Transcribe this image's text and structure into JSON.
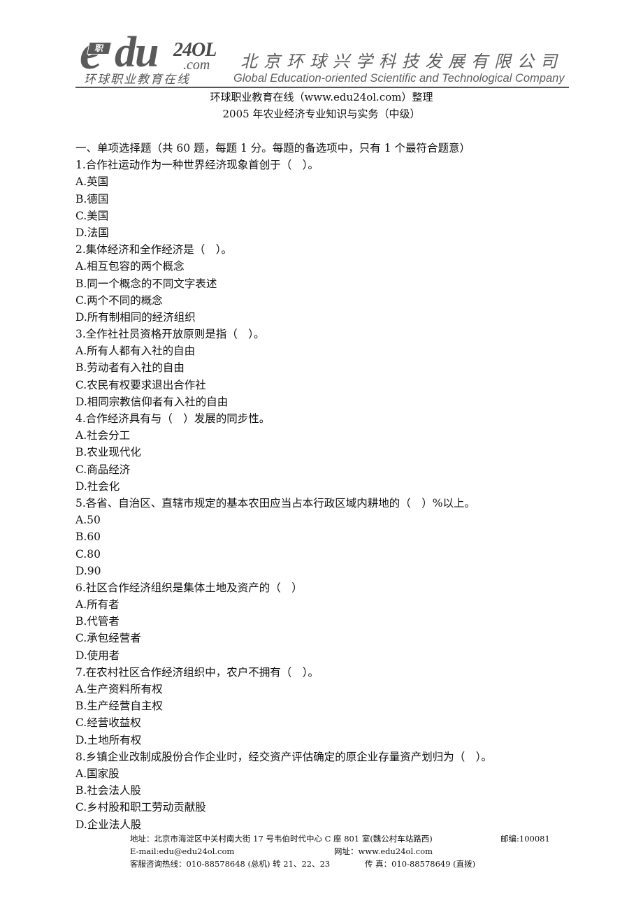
{
  "letterhead": {
    "logo_badge": "职",
    "logo_e": "e",
    "logo_du": "du",
    "logo_24ol": "24OL",
    "logo_com": ".com",
    "logo_cn": "环球职业教育在线",
    "company_cn": "北京环球兴学科技发展有限公司",
    "company_en": "Global Education-oriented Scientific and Technological Company",
    "brand_color": "#5a5a5a"
  },
  "titles": {
    "source": "环球职业教育在线（www.edu24ol.com）整理",
    "exam": "2005 年农业经济专业知识与实务（中级）"
  },
  "section": {
    "heading": "一、单项选择题（共 60 题，每题 1 分。每题的备选项中，只有 1 个最符合题意）"
  },
  "questions": [
    {
      "stem": "1.合作社运动作为一种世界经济现象首创于（　）。",
      "options": [
        "A.英国",
        "B.德国",
        "C.美国",
        "D.法国"
      ]
    },
    {
      "stem": "2.集体经济和全作经济是（　）。",
      "options": [
        "A.相互包容的两个概念",
        "B.同一个概念的不同文字表述",
        "C.两个不同的概念",
        "D.所有制相同的经济组织"
      ]
    },
    {
      "stem": "3.全作社社员资格开放原则是指（　）。",
      "options": [
        "A.所有人都有入社的自由",
        "B.劳动者有入社的自由",
        "C.农民有权要求退出合作社",
        "D.相同宗教信仰者有入社的自由"
      ]
    },
    {
      "stem": "4.合作经济具有与（　）发展的同步性。",
      "options": [
        "A.社会分工",
        "B.农业现代化",
        "C.商品经济",
        "D.社会化"
      ]
    },
    {
      "stem": "5.各省、自治区、直辖市规定的基本农田应当占本行政区域内耕地的（　）%以上。",
      "options": [
        "A.50",
        "B.60",
        "C.80",
        "D.90"
      ]
    },
    {
      "stem": "6.社区合作经济组织是集体土地及资产的（　）",
      "options": [
        "A.所有者",
        "B.代管者",
        "C.承包经营者",
        "D.使用者"
      ]
    },
    {
      "stem": "7.在农村社区合作经济组织中，农户不拥有（　）。",
      "options": [
        "A.生产资料所有权",
        "B.生产经营自主权",
        "C.经营收益权",
        "D.土地所有权"
      ]
    },
    {
      "stem": "8.乡镇企业改制成股份合作企业时，经交资产评估确定的原企业存量资产划归为（　）。",
      "options": [
        "A.国家股",
        "B.社会法人股",
        "C.乡村股和职工劳动贡献股",
        "D.企业法人股"
      ]
    }
  ],
  "footer": {
    "address": "地址：北京市海淀区中关村南大街 17 号韦伯时代中心 C 座 801 室(魏公村车站路西)",
    "postcode": "邮编:100081",
    "email": "E-mail:edu@edu24ol.com",
    "website": "网址：www.edu24ol.com",
    "hotline": "客服咨询热线：010-88578648 (总机) 转 21、22、23",
    "fax": "传 真：010-88578649 (直拨)"
  }
}
